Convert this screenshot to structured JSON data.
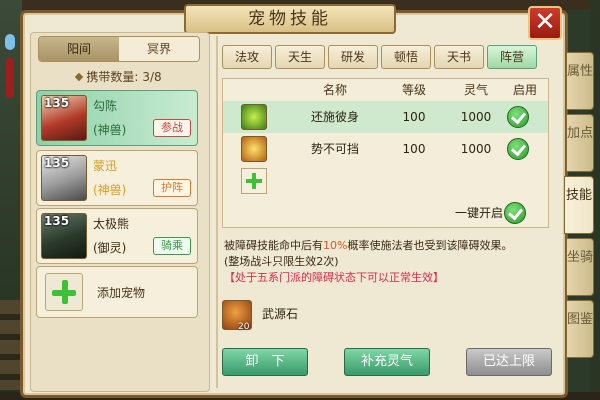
{
  "window": {
    "title": "宠物技能",
    "close_label": "✕"
  },
  "realm_tabs": [
    {
      "label": "阳间",
      "active": true
    },
    {
      "label": "冥界",
      "active": false
    }
  ],
  "carry": {
    "label": "携带数量:",
    "value": "3/8"
  },
  "pets": [
    {
      "level": "135",
      "name": "勾陈",
      "type": "(神兽)",
      "tag": "参战",
      "name_color": "#2a6a3a",
      "type_color": "#2a6a3a"
    },
    {
      "level": "135",
      "name": "蒙迅",
      "type": "(神兽)",
      "tag": "护阵",
      "name_color": "#d6a020",
      "type_color": "#d6a020"
    },
    {
      "level": "135",
      "name": "太极熊",
      "type": "(御灵)",
      "tag": "骑乘",
      "name_color": "#3a2a12",
      "type_color": "#3a2a12"
    }
  ],
  "add_pet": {
    "label": "添加宠物"
  },
  "skill_tabs": [
    {
      "label": "法攻",
      "active": false
    },
    {
      "label": "天生",
      "active": false
    },
    {
      "label": "研发",
      "active": false
    },
    {
      "label": "顿悟",
      "active": false
    },
    {
      "label": "天书",
      "active": false
    },
    {
      "label": "阵营",
      "active": true
    }
  ],
  "skill_table": {
    "headers": {
      "name": "名称",
      "level": "等级",
      "spirit": "灵气",
      "enable": "启用"
    },
    "rows": [
      {
        "name": "还施彼身",
        "level": "100",
        "spirit": "1000",
        "enabled": true
      },
      {
        "name": "势不可挡",
        "level": "100",
        "spirit": "1000",
        "enabled": true
      }
    ],
    "one_key_label": "一键开启"
  },
  "description": {
    "line1_a": "被障碍技能命中后有",
    "line1_pct": "10%",
    "line1_b": "概率使施法者也受到该障碍效果。",
    "line2": "(整场战斗只限生效2次)",
    "line3": "【处于五系门派的障碍状态下可以正常生效】"
  },
  "item": {
    "name": "武源石",
    "count": "20"
  },
  "buttons": {
    "unload": "卸　下",
    "refill": "补充灵气",
    "max": "已达上限"
  },
  "side_tabs": [
    {
      "label": "属性",
      "active": false
    },
    {
      "label": "加点",
      "active": false
    },
    {
      "label": "技能",
      "active": true
    },
    {
      "label": "坐骑",
      "active": false
    },
    {
      "label": "图鉴",
      "active": false
    }
  ]
}
